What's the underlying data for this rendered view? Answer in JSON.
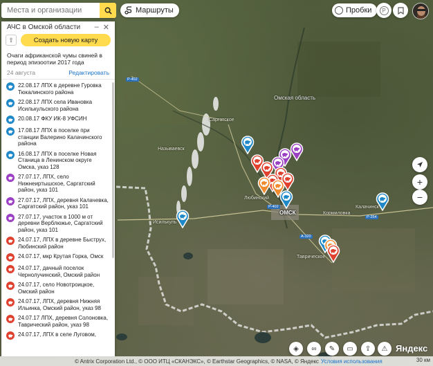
{
  "search": {
    "placeholder": "Места и организации"
  },
  "toolbar": {
    "routes_label": "Маршруты",
    "traffic_label": "Пробки"
  },
  "panel": {
    "title": "АЧС в Омской области",
    "new_map_label": "Создать новую карту",
    "description": "Очаги африканской чумы свиней в период эпизоотии 2017 года",
    "date": "24 августа",
    "edit_label": "Редактировать",
    "items": [
      {
        "text": "22.08.17 ЛПХ в деревне Гуровка Тюкалинского района",
        "color": "#1e88c8"
      },
      {
        "text": "22.08.17 ЛПХ села Ивановка Исилькульского района",
        "color": "#1e88c8"
      },
      {
        "text": "20.08.17 ФКУ ИК-8 УФСИН",
        "color": "#1e88c8"
      },
      {
        "text": "17.08.17 ЛПХ в поселке при станции Валерино Калачинского района",
        "color": "#1e88c8"
      },
      {
        "text": "16.08.17 ЛПХ в поселке Новая Станица в Ленинском округе Омска, указ 128",
        "color": "#1e88c8"
      },
      {
        "text": "27.07.17, ЛПХ, село Нижнеиртышское, Саргатский район, указ 101",
        "color": "#9b3fc4"
      },
      {
        "text": "27.07.17, ЛПХ, деревня Калачевка, Саргатский район, указ 101",
        "color": "#9b3fc4"
      },
      {
        "text": "27.07.17, участок в 1000 м от деревни Верблюжье, Саргатский район, указ 101",
        "color": "#9b3fc4"
      },
      {
        "text": "24.07.17, ЛПХ в деревне Быструх, Любинский район",
        "color": "#e0412e"
      },
      {
        "text": "24.07.17, мкр Крутая Горка, Омск",
        "color": "#e0412e"
      },
      {
        "text": "24.07.17, дачный поселок Чернолучинский, Омский район",
        "color": "#e0412e"
      },
      {
        "text": "24.07.17, село Новотроицкое, Омский район",
        "color": "#e0412e"
      },
      {
        "text": "24.07.17, ЛПХ, деревня Нижняя Ильинка, Омский район, указ 98",
        "color": "#e0412e"
      },
      {
        "text": "24.07.17 ЛПХ, деревня Солоновка, Таврический район, указ 98",
        "color": "#e0412e"
      },
      {
        "text": "24.07.17, ЛПХ в селе Луговом,",
        "color": "#e0412e"
      }
    ]
  },
  "map": {
    "labels": {
      "tavricheskoe": "Таврическое",
      "lyubinsky": "Любинский",
      "omsk": "ОМСК",
      "kalachinsk": "Калачинск",
      "kormilovka": "Кормиловка",
      "isilkul": "Исилькуль",
      "nazyvaevsk": "Называевск",
      "sargatskoe": "Саргатское",
      "region": "Омская область"
    },
    "roads": [
      "Р-402",
      "Р-254",
      "А-320",
      "Р-402"
    ],
    "markers": [
      {
        "color": "#1e88c8"
      },
      {
        "color": "#1e88c8"
      },
      {
        "color": "#1e88c8"
      },
      {
        "color": "#1e88c8"
      },
      {
        "color": "#1e88c8"
      },
      {
        "color": "#9b3fc4"
      },
      {
        "color": "#9b3fc4"
      },
      {
        "color": "#9b3fc4"
      },
      {
        "color": "#e0412e"
      },
      {
        "color": "#e0412e"
      },
      {
        "color": "#e0412e"
      },
      {
        "color": "#e0412e"
      },
      {
        "color": "#f28a2e"
      },
      {
        "color": "#f28a2e"
      },
      {
        "color": "#e0412e"
      },
      {
        "color": "#f28a2e"
      },
      {
        "color": "#e0412e"
      }
    ]
  },
  "footer": {
    "copyright": "© Antrix Corporation Ltd., © ООО ИТЦ «СКАНЭКС», © Earthstar Geographics, © NASA, © Яндекс",
    "terms": "Условия использования",
    "scale": "30 км",
    "logo": "Яндекс"
  }
}
